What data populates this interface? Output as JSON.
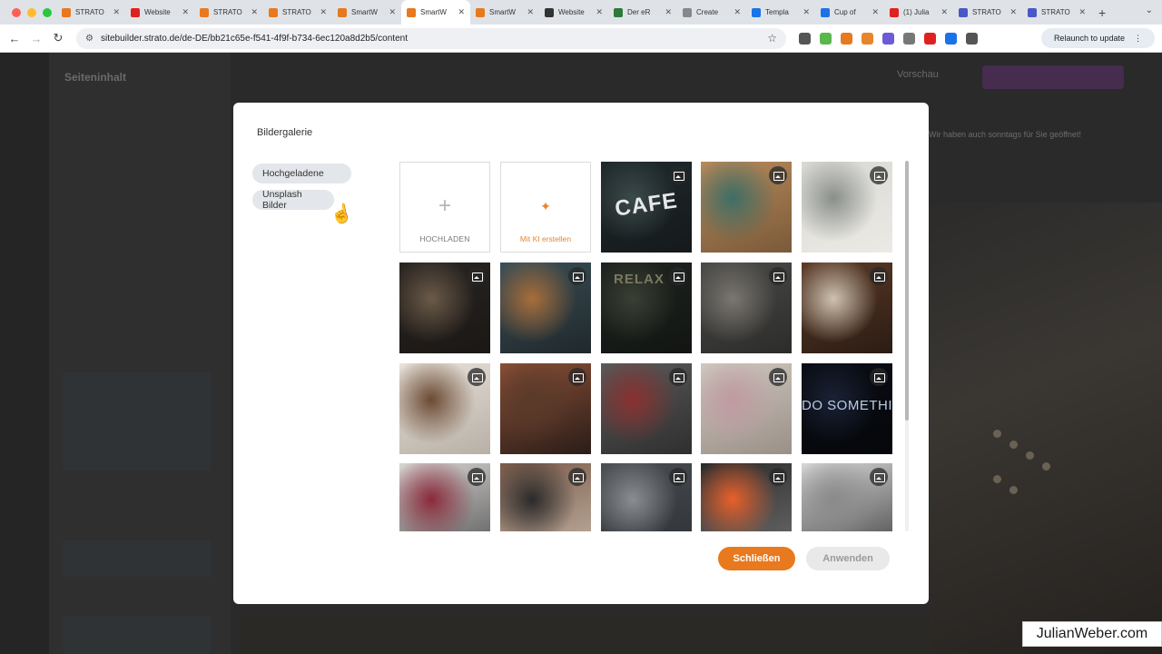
{
  "browser": {
    "tabs": [
      {
        "title": "STRATO",
        "color": "#e8791e",
        "active": false
      },
      {
        "title": "Website",
        "color": "#e02020",
        "active": false
      },
      {
        "title": "STRATO",
        "color": "#e8791e",
        "active": false
      },
      {
        "title": "STRATO",
        "color": "#e8791e",
        "active": false
      },
      {
        "title": "SmartW",
        "color": "#e8791e",
        "active": false
      },
      {
        "title": "SmartW",
        "color": "#e8791e",
        "active": true
      },
      {
        "title": "SmartW",
        "color": "#e8791e",
        "active": false
      },
      {
        "title": "Website",
        "color": "#333333",
        "active": false
      },
      {
        "title": "Der eR",
        "color": "#2d7a3a",
        "active": false
      },
      {
        "title": "Create",
        "color": "#888888",
        "active": false
      },
      {
        "title": "Templa",
        "color": "#1a73e8",
        "active": false
      },
      {
        "title": "Cup of",
        "color": "#1a73e8",
        "active": false
      },
      {
        "title": "(1) Julia",
        "color": "#e02020",
        "active": false
      },
      {
        "title": "STRATO",
        "color": "#4a57c9",
        "active": false
      },
      {
        "title": "STRATO",
        "color": "#4a57c9",
        "active": false
      }
    ],
    "new_tab": "+",
    "url": "sitebuilder.strato.de/de-DE/bb21c65e-f541-4f9f-b734-6ec120a8d2b5/content",
    "relaunch_label": "Relaunch to update",
    "extension_colors": [
      "#555555",
      "#58b84a",
      "#e8791e",
      "#e8852b",
      "#6b5bd6",
      "#777777",
      "#e02020",
      "#1a73e8",
      "#555555"
    ]
  },
  "app": {
    "page_title": "Seiteninhalt",
    "preview_label": "Vorschau",
    "notice": "Wir haben auch sonntags für Sie geöffnet!"
  },
  "modal": {
    "title": "Bildergalerie",
    "sources": [
      {
        "label": "Hochgeladene"
      },
      {
        "label": "Unsplash Bilder"
      }
    ],
    "upload_label": "HOCHLADEN",
    "ai_label": "Mit KI erstellen",
    "photos": [
      {
        "name": "photo-cafe-sign",
        "colors": [
          "#1f2a2c",
          "#3c4a4a",
          "#15191b"
        ],
        "sign": "CAFE"
      },
      {
        "name": "photo-coffee-desk",
        "colors": [
          "#b98a5a",
          "#3d6e66",
          "#7a5a3a"
        ]
      },
      {
        "name": "photo-bright-cafe",
        "colors": [
          "#d8d8d4",
          "#8a8f8a",
          "#eceae5"
        ]
      },
      {
        "name": "photo-cafe-counter",
        "colors": [
          "#2a2522",
          "#6b5a48",
          "#1a1715"
        ]
      },
      {
        "name": "photo-bar-interior",
        "colors": [
          "#3a4f57",
          "#a86e3a",
          "#20282b"
        ]
      },
      {
        "name": "photo-relax-wall",
        "colors": [
          "#1f2420",
          "#3a3f33",
          "#121512"
        ],
        "sign": "RELAX"
      },
      {
        "name": "photo-industrial-cafe",
        "colors": [
          "#4a4a48",
          "#7a7670",
          "#2c2c2a"
        ]
      },
      {
        "name": "photo-coffee-cups",
        "colors": [
          "#5b3a26",
          "#cfc2b0",
          "#2b1c14"
        ]
      },
      {
        "name": "photo-latte-art",
        "colors": [
          "#e8e2da",
          "#6b4a32",
          "#b8b0a6"
        ]
      },
      {
        "name": "photo-brick-wall",
        "colors": [
          "#8a4f36",
          "#5a3a2a",
          "#2a1d18"
        ]
      },
      {
        "name": "photo-gym-workout",
        "colors": [
          "#5a5a5a",
          "#8a3030",
          "#2f2f2f"
        ]
      },
      {
        "name": "photo-yoga",
        "colors": [
          "#d0c8c0",
          "#c09aa0",
          "#9a9088"
        ]
      },
      {
        "name": "photo-neon-sign",
        "colors": [
          "#0a0d14",
          "#1a2235",
          "#05070a"
        ],
        "sign": "DO SOMETHING GR"
      },
      {
        "name": "photo-trainer-session",
        "colors": [
          "#d8d6d4",
          "#8a2a3a",
          "#5a5a5a"
        ]
      },
      {
        "name": "photo-gym-trainers",
        "colors": [
          "#7a5a4a",
          "#2a2a2a",
          "#c0b0a0"
        ]
      },
      {
        "name": "photo-gym-floor",
        "colors": [
          "#4a4e52",
          "#8a8e92",
          "#2e3236"
        ]
      },
      {
        "name": "photo-orange-shirt",
        "colors": [
          "#2a2a2a",
          "#e8602a",
          "#6a6a6a"
        ]
      },
      {
        "name": "photo-box-jump",
        "colors": [
          "#d6d6d6",
          "#8a8a8a",
          "#4a4a4a"
        ]
      }
    ],
    "close_label": "Schließen",
    "apply_label": "Anwenden"
  },
  "watermark": "JulianWeber.com"
}
